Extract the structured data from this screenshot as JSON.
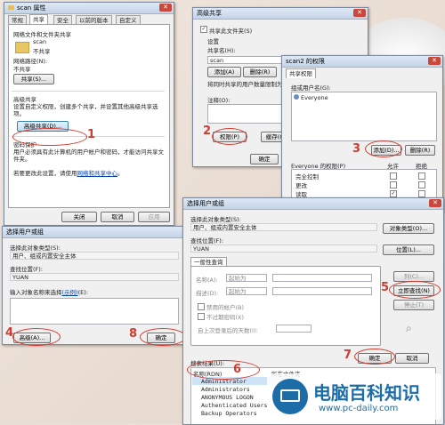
{
  "scan_props": {
    "title": "scan 属性",
    "tabs": [
      "常规",
      "共享",
      "安全",
      "以前的版本",
      "自定义"
    ],
    "net_share_header": "网络文件和文件夹共享",
    "folder_name": "scan",
    "folder_state": "不共享",
    "net_path_label": "网络路径(N):",
    "net_path_value": "不共享",
    "share_button": "共享(S)...",
    "adv_header": "高级共享",
    "adv_desc": "设置自定义权限，创建多个共享，并设置其他高级共享选项。",
    "adv_button": "高级共享(D)...",
    "pwd_header": "密码保护",
    "pwd_desc": "用户必须具有此计算机的用户帐户和密码，才能访问共享文件夹。",
    "pwd_desc2": "若要更改此设置，请使用",
    "pwd_link": "网络和共享中心",
    "pwd_end": "。",
    "close_button": "关闭",
    "cancel_button": "取消",
    "apply_button": "应用"
  },
  "adv_share": {
    "title": "高级共享",
    "share_checkbox": "共享此文件夹(S)",
    "settings_label": "设置",
    "share_name_label": "共享名(H):",
    "share_name_value": "scan",
    "add_button": "添加(A)",
    "remove_button": "删除(R)",
    "limit_label": "将同时共享的用户数量限制为",
    "comment_label": "注释(O):",
    "perm_button": "权限(P)",
    "cache_button": "缓存(C)",
    "ok_button": "确定"
  },
  "scan2_perm": {
    "title": "scan2 的权限",
    "tab": "共享权限",
    "group_label": "组或用户名(G):",
    "users": [
      "Everyone"
    ],
    "add_button": "添加(D)...",
    "remove_button": "删除(R)",
    "perm_header": "Everyone 的权限(P)",
    "allow_col": "允许",
    "deny_col": "拒绝",
    "perms": [
      {
        "name": "完全控制",
        "allow": false,
        "deny": false
      },
      {
        "name": "更改",
        "allow": false,
        "deny": false
      },
      {
        "name": "读取",
        "allow": true,
        "deny": false
      }
    ]
  },
  "select_small": {
    "title": "选择用户或组",
    "obj_type_label": "选择此对象类型(S):",
    "obj_type_value": "用户、组或内置安全主体",
    "location_label": "查找位置(F):",
    "location_value": "YUAN",
    "enter_label": "输入对象名称来选择",
    "enter_link": "(示例)",
    "enter_end": "(E):",
    "advanced_button": "高级(A)...",
    "ok_button": "确定"
  },
  "select_big": {
    "title": "选择用户或组",
    "obj_type_label": "选择此对象类型(S):",
    "obj_type_value": "用户、组或内置安全主体",
    "obj_type_button": "对象类型(O)...",
    "location_label": "查找位置(F):",
    "location_value": "YUAN",
    "location_button": "位置(L)...",
    "query_tab": "一般性查询",
    "name_label": "名称(A):",
    "name_op": "起始为",
    "desc_label": "描述(D):",
    "desc_op": "起始为",
    "col_button": "列(C)...",
    "find_button": "立即查找(N)",
    "stop_button": "停止(T)",
    "disabled_chk": "禁用的帐户(B)",
    "noexpire_chk": "不过期密码(X)",
    "days_label": "自上次登录后的天数(I):",
    "results_label": "搜索结果(U):",
    "ok_button": "确定",
    "cancel_button": "取消",
    "result_cols": [
      "名称(RDN)",
      "所在文件夹"
    ],
    "results": [
      "Administrator",
      "Administrators",
      "ANONYMOUS LOGON",
      "Authenticated Users",
      "Backup Operators"
    ]
  },
  "steps": [
    "1",
    "2",
    "3",
    "4",
    "5",
    "6",
    "7",
    "8"
  ],
  "watermark": {
    "title": "电脑百科知识",
    "url": "www.pc-daily.com"
  },
  "colors": {
    "accent_red": "#d23b2f",
    "title_blue": "#c3d4e8",
    "brand_blue": "#1c6ca8"
  }
}
